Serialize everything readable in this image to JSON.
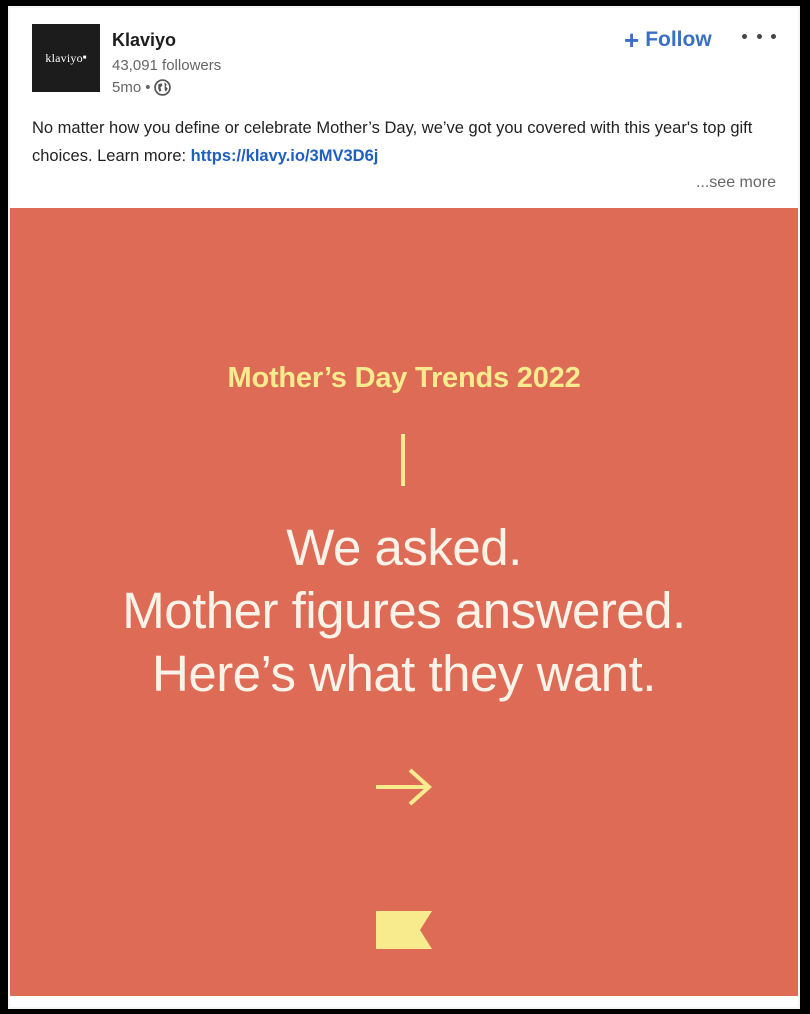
{
  "post": {
    "company_name": "Klaviyo",
    "logo_text": "klaviyo",
    "logo_mark": "■",
    "followers": "43,091 followers",
    "age": "5mo",
    "separator": "•",
    "visibility_icon": "globe-icon",
    "follow_icon": "+",
    "follow_label": "Follow",
    "more_icon": "ellipsis-icon",
    "text": "No matter how you define or celebrate Mother’s Day, we’ve got you covered with this year's top gift choices. Learn more: ",
    "link_text": "https://klavy.io/3MV3D6j",
    "see_more": "...see more"
  },
  "image": {
    "title": "Mother’s Day Trends 2022",
    "headline_lines": [
      "We asked.",
      "Mother figures answered.",
      "Here’s what they want."
    ],
    "arrow_icon": "arrow-right-icon",
    "brand_icon": "klaviyo-flag-icon"
  },
  "colors": {
    "image_background": "#dd6b56",
    "accent_yellow": "#f7eb8e",
    "headline_text": "#fbf2e8",
    "link_blue": "#1f5fbf",
    "follow_blue": "#3a6fc4"
  }
}
